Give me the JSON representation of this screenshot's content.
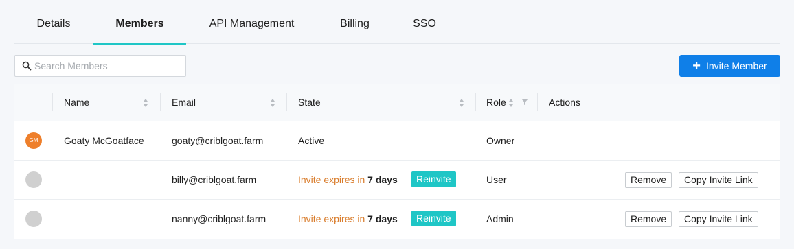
{
  "tabs": [
    {
      "label": "Details"
    },
    {
      "label": "Members"
    },
    {
      "label": "API Management"
    },
    {
      "label": "Billing"
    },
    {
      "label": "SSO"
    }
  ],
  "search": {
    "placeholder": "Search Members"
  },
  "invite_button": {
    "label": "Invite Member"
  },
  "table": {
    "columns": {
      "name": "Name",
      "email": "Email",
      "state": "State",
      "role": "Role",
      "actions": "Actions"
    },
    "rows": [
      {
        "avatar_initials": "GM",
        "name": "Goaty McGoatface",
        "email": "goaty@criblgoat.farm",
        "state": "Active",
        "role": "Owner"
      },
      {
        "avatar_initials": "",
        "name": "",
        "email": "billy@criblgoat.farm",
        "state_prefix": "Invite expires in",
        "state_days": "7 days",
        "reinvite": "Reinvite",
        "role": "User",
        "remove": "Remove",
        "copy_link": "Copy Invite Link"
      },
      {
        "avatar_initials": "",
        "name": "",
        "email": "nanny@criblgoat.farm",
        "state_prefix": "Invite expires in",
        "state_days": "7 days",
        "reinvite": "Reinvite",
        "role": "Admin",
        "remove": "Remove",
        "copy_link": "Copy Invite Link"
      }
    ]
  },
  "colors": {
    "accent": "#1fc6c6",
    "primary": "#0f7fe8",
    "warning_text": "#d97c2b",
    "avatar_gm": "#ee7f2b"
  }
}
